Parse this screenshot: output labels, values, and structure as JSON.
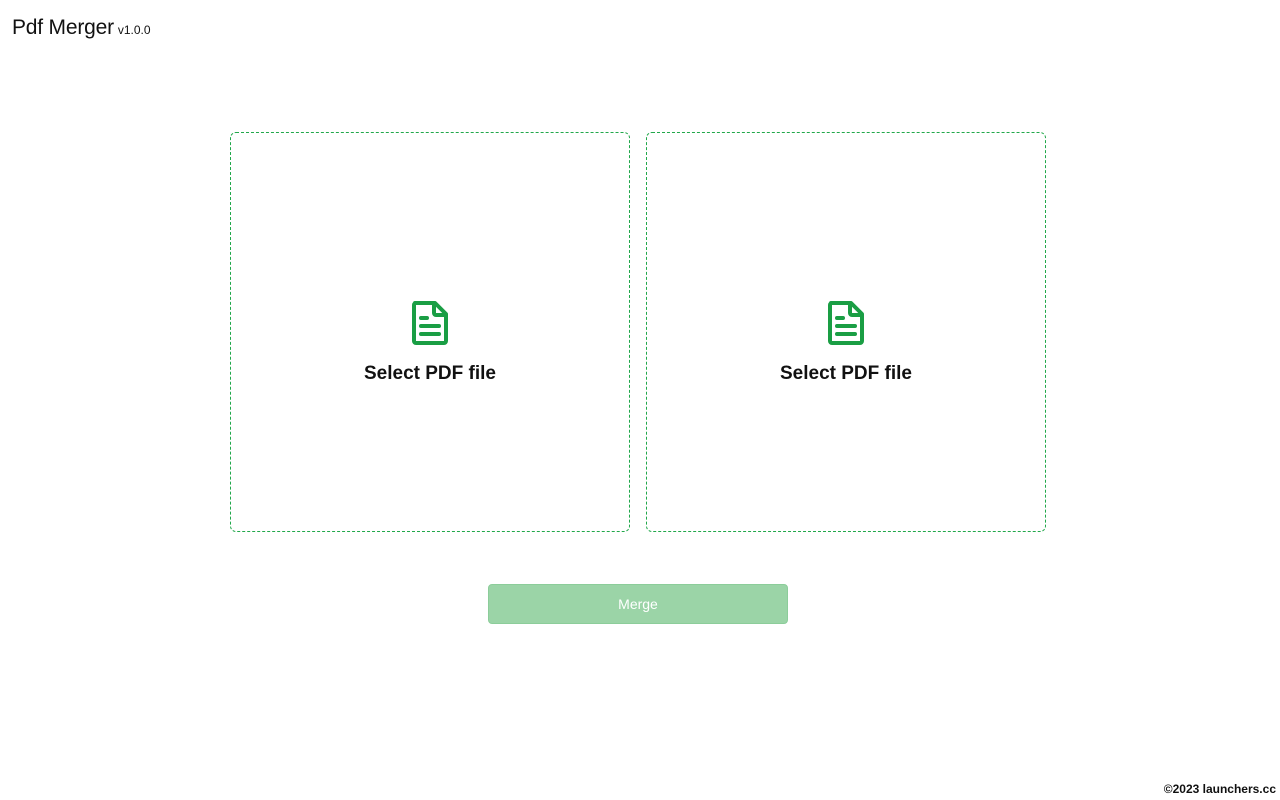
{
  "header": {
    "title": "Pdf Merger",
    "version": "v1.0.0"
  },
  "drop_zones": [
    {
      "label": "Select PDF file",
      "icon": "file-text-icon"
    },
    {
      "label": "Select PDF file",
      "icon": "file-text-icon"
    }
  ],
  "merge_button": {
    "label": "Merge",
    "state": "disabled"
  },
  "footer": {
    "copyright": "©2023 launchers.cc"
  },
  "colors": {
    "accent": "#21a84a",
    "button_disabled": "#9bd4a7",
    "text": "#111111",
    "background": "#ffffff"
  }
}
